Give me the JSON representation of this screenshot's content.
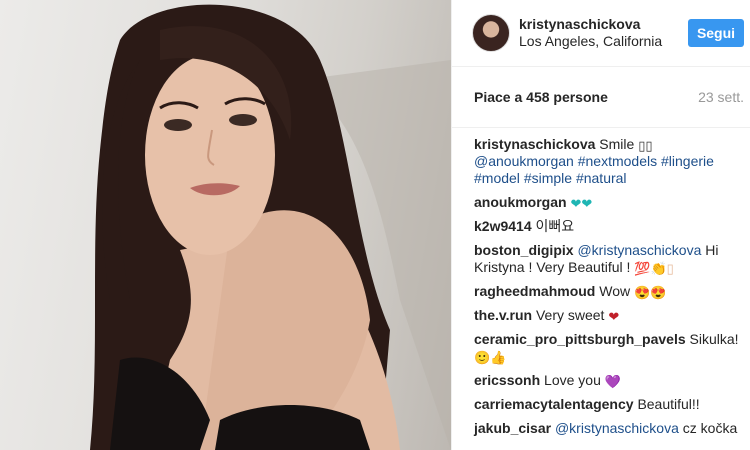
{
  "header": {
    "username": "kristynaschickova",
    "location": "Los Angeles, California",
    "follow_label": "Segui"
  },
  "post": {
    "likes": "Piace a 458 persone",
    "date": "23 sett."
  },
  "caption": {
    "user": "kristynaschickova",
    "text": "Smile",
    "boxes": "▯▯",
    "tags": [
      "@anoukmorgan",
      "#nextmodels",
      "#lingerie",
      "#model",
      "#simple",
      "#natural"
    ]
  },
  "comments": [
    {
      "user": "anoukmorgan",
      "text": "",
      "emoji": "❤❤",
      "emoji_icon": "teal-hearts-icon"
    },
    {
      "user": "k2w9414",
      "text": "이뻐요"
    },
    {
      "user": "boston_digipix",
      "mention": "@kristynaschickova",
      "text": "Hi Kristyna ! Very Beautiful !",
      "emoji": "💯👏▯"
    },
    {
      "user": "ragheedmahmoud",
      "text": "Wow",
      "emoji": "😍😍"
    },
    {
      "user": "the.v.run",
      "text": "Very sweet",
      "emoji": "❤"
    },
    {
      "user": "ceramic_pro_pittsburgh_pavels",
      "text": "Sikulka!",
      "emoji": "🙂👍"
    },
    {
      "user": "ericssonh",
      "text": "Love you",
      "emoji": "💜"
    },
    {
      "user": "carriemacytalentagency",
      "text": "Beautiful!!"
    },
    {
      "user": "jakub_cisar",
      "mention": "@kristynaschickova",
      "text": "cz kočka"
    }
  ],
  "colors": {
    "follow_button": "#3897f0",
    "hashtag": "#1e4f8a",
    "divider": "#efefef"
  }
}
